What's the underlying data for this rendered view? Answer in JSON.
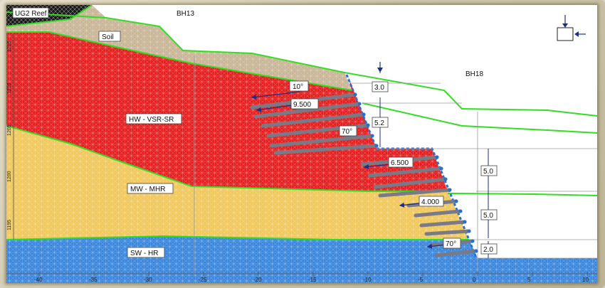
{
  "title_tag": "UG2 Reef",
  "boreholes": {
    "left": "BH13",
    "right": "BH18"
  },
  "materials": {
    "soil": "Soil",
    "hw": "HW - VSR-SR",
    "mw": "MW - MHR",
    "sw": "SW - HR"
  },
  "callouts": {
    "angle_top": "10°",
    "length_top": "9.500",
    "angle_mid": "70°",
    "length_mid": "6.500",
    "length_low": "4.000",
    "angle_low": "70°"
  },
  "dimensions": {
    "d1": "3.0",
    "d2": "5.2",
    "d3": "5.0",
    "d4": "5.0",
    "d5": "2.0"
  },
  "x_axis": {
    "ticks": [
      "-40",
      "-35",
      "-30",
      "-25",
      "-20",
      "-15",
      "-10",
      "-5",
      "0",
      "5",
      "10"
    ]
  },
  "y_axis": {
    "ticks": [
      "1215",
      "1210",
      "1205",
      "1200",
      "1195"
    ]
  },
  "colors": {
    "soil": "#c8b596",
    "hw": "#e41e1e",
    "mw": "#f0c75a",
    "sw": "#3a86dd",
    "boundary": "#33dd22",
    "anchor": "#7a7a86",
    "mesh": "#ffffff"
  },
  "icons": {
    "water_table": "water-table-icon",
    "groundwater": "groundwater-arrow-icon"
  }
}
